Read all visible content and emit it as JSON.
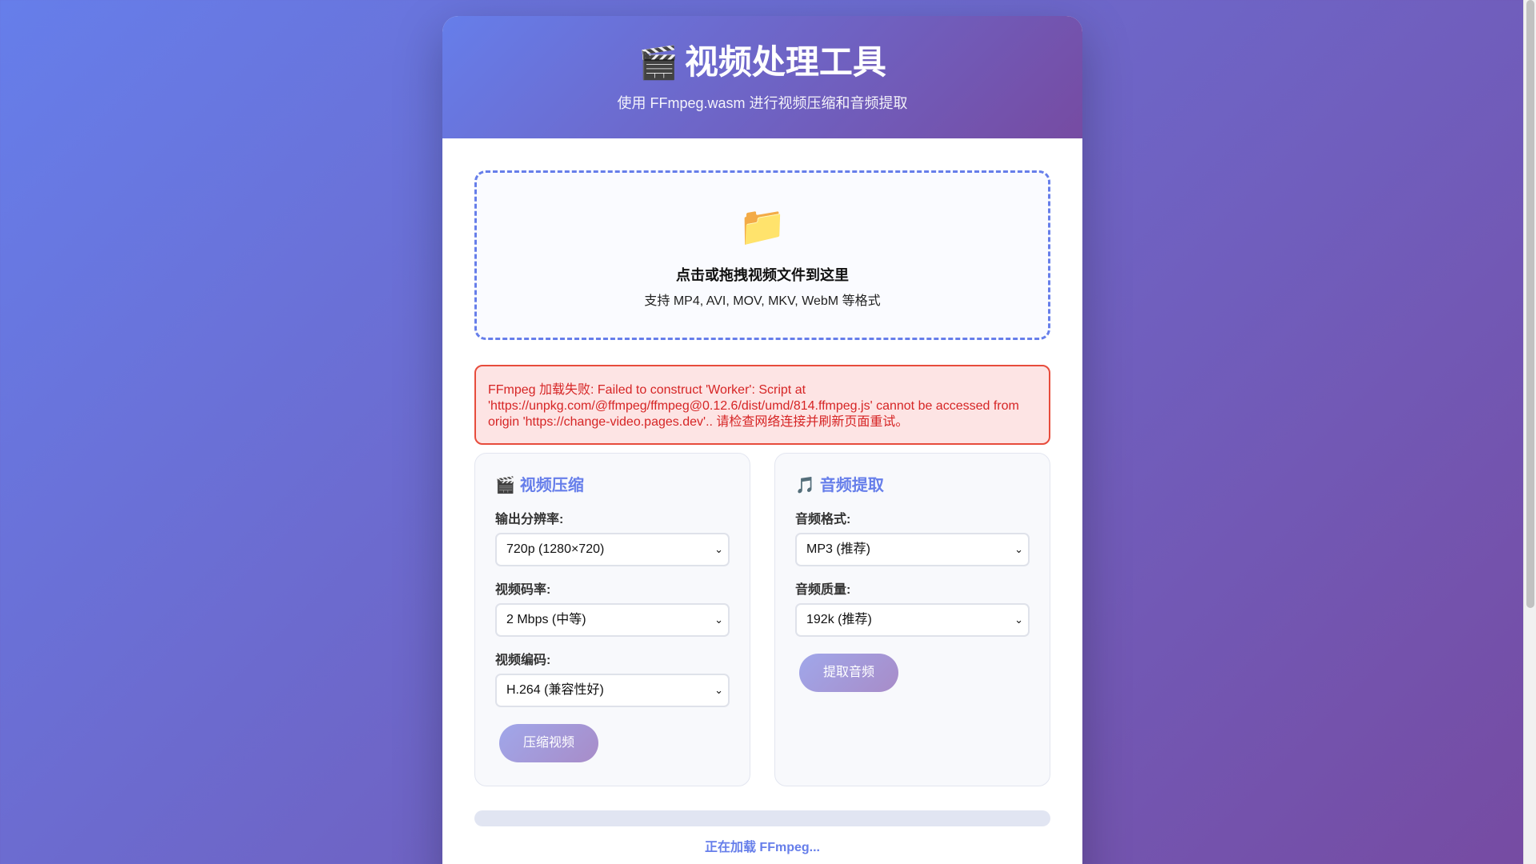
{
  "header": {
    "icon": "clapperboard-icon",
    "title_emoji": "🎬",
    "title": "视频处理工具",
    "subtitle": "使用 FFmpeg.wasm 进行视频压缩和音频提取"
  },
  "upload": {
    "icon": "folder-icon",
    "icon_glyph": "📁",
    "title": "点击或拖拽视频文件到这里",
    "subtitle": "支持 MP4, AVI, MOV, MKV, WebM 等格式"
  },
  "error": {
    "message": "FFmpeg 加载失败: Failed to construct 'Worker': Script at 'https://unpkg.com/@ffmpeg/ffmpeg@0.12.6/dist/umd/814.ffmpeg.js' cannot be accessed from origin 'https://change-video.pages.dev'.. 请检查网络连接并刷新页面重试。"
  },
  "compress": {
    "icon": "clapperboard-icon",
    "icon_glyph": "🎬",
    "title": "视频压缩",
    "resolution_label": "输出分辨率:",
    "resolution_value": "720p (1280×720)",
    "bitrate_label": "视频码率:",
    "bitrate_value": "2 Mbps (中等)",
    "codec_label": "视频编码:",
    "codec_value": "H.264 (兼容性好)",
    "button": "压缩视频"
  },
  "audio": {
    "icon": "music-note-icon",
    "icon_glyph": "🎵",
    "title": "音频提取",
    "format_label": "音频格式:",
    "format_value": "MP3 (推荐)",
    "quality_label": "音频质量:",
    "quality_value": "192k (推荐)",
    "button": "提取音频"
  },
  "progress": {
    "fraction": 0
  },
  "status": "正在加载 FFmpeg..."
}
